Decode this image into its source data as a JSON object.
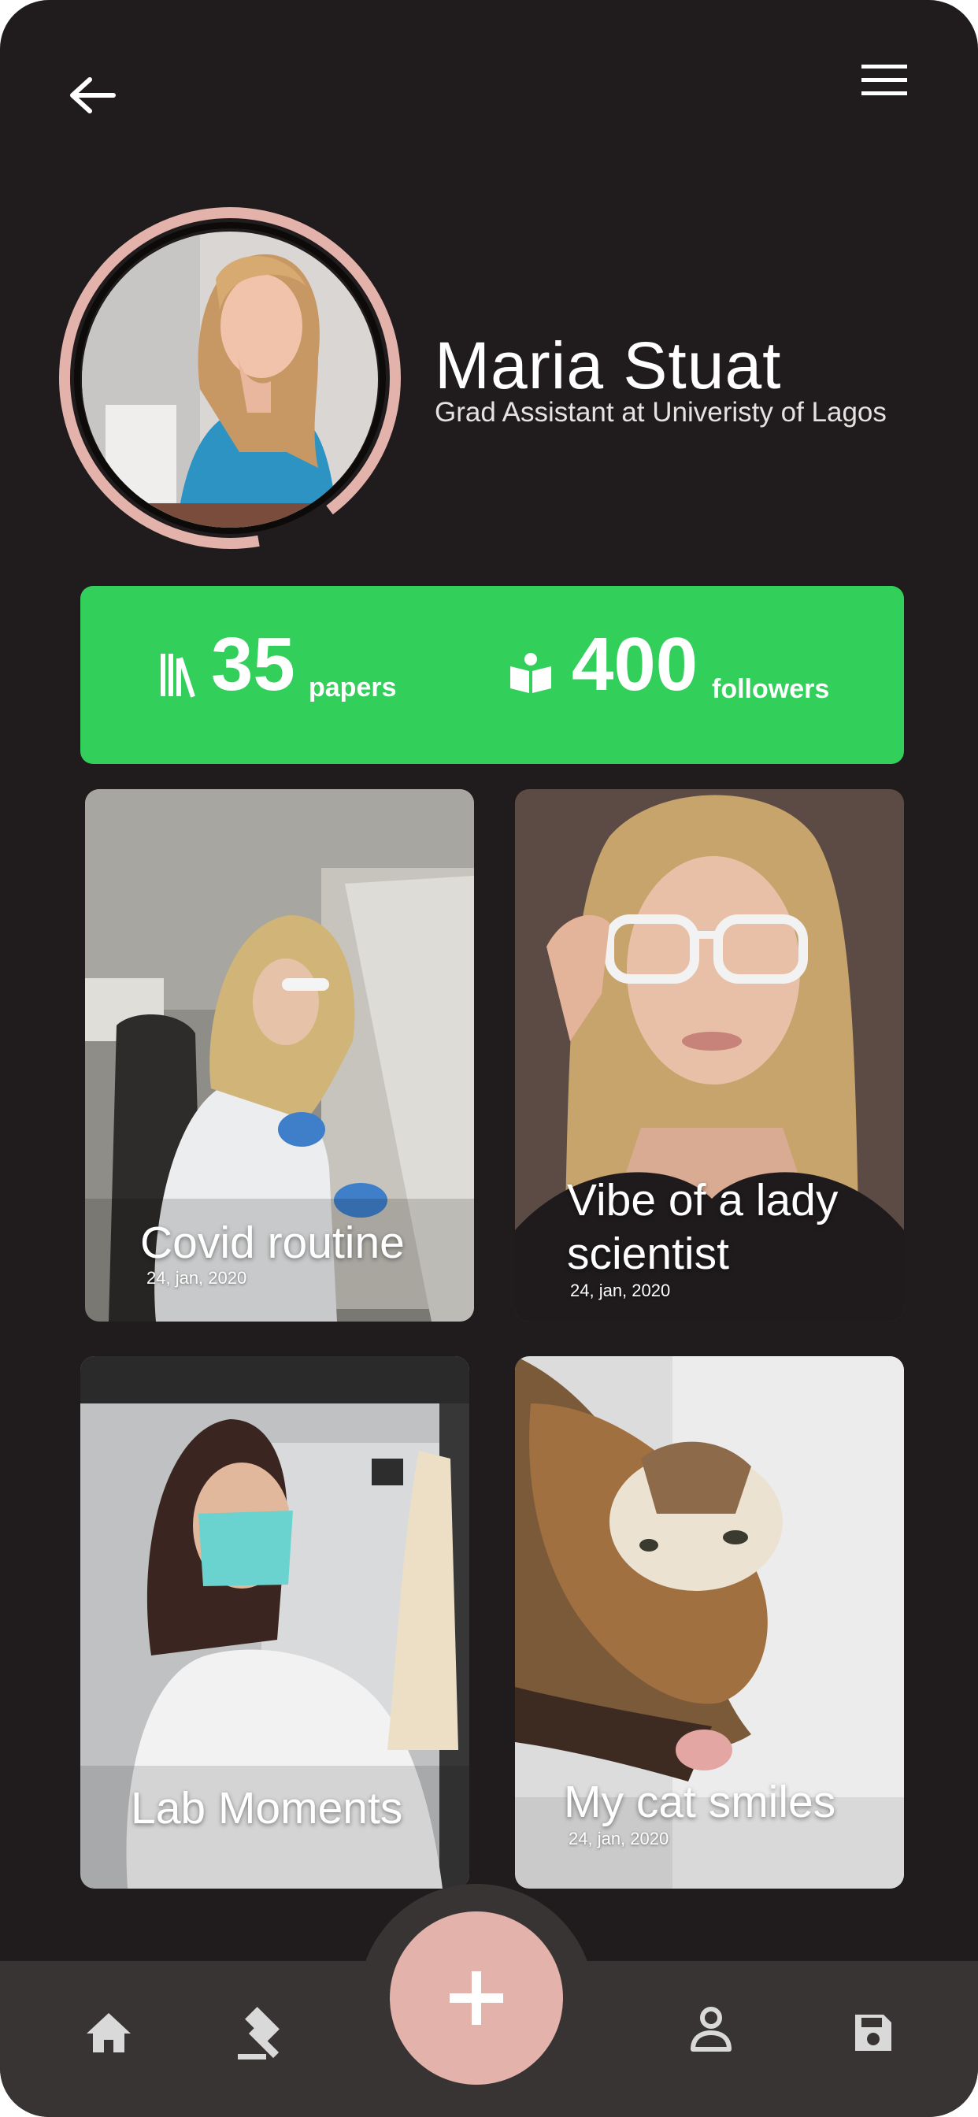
{
  "colors": {
    "background": "#201b1c",
    "accent_green": "#32d05b",
    "accent_pink": "#e2b2ab",
    "navbar": "#383434",
    "text": "#ffffff"
  },
  "header": {
    "back_icon": "arrow-left-icon",
    "menu_icon": "hamburger-menu-icon"
  },
  "profile": {
    "name": "Maria Stuat",
    "role": "Grad Assistant at Univeristy of Lagos"
  },
  "stats": [
    {
      "icon": "books-icon",
      "value": "35",
      "label": "papers"
    },
    {
      "icon": "reader-icon",
      "value": "400",
      "label": "followers"
    }
  ],
  "cards": [
    {
      "title": "Covid routine",
      "date": "24, jan, 2020"
    },
    {
      "title": "Vibe  of a lady\nscientist",
      "date": "24, jan, 2020"
    },
    {
      "title": "Lab Moments",
      "date": ""
    },
    {
      "title": "My cat smiles",
      "date": "24, jan, 2020"
    }
  ],
  "navbar": {
    "items": [
      {
        "icon": "home-icon"
      },
      {
        "icon": "gavel-icon"
      },
      {
        "icon": "add-icon"
      },
      {
        "icon": "person-icon"
      },
      {
        "icon": "save-icon"
      }
    ]
  }
}
